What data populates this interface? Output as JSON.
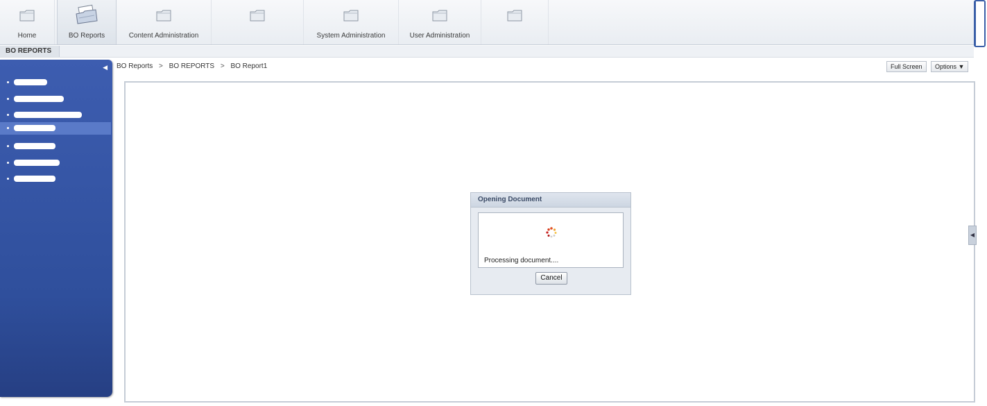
{
  "nav": {
    "tabs": [
      {
        "label": "Home",
        "icon": "folder-icon"
      },
      {
        "label": "BO Reports",
        "icon": "reports-icon",
        "active": true
      },
      {
        "label": "Content Administration",
        "icon": "folder-icon"
      },
      {
        "label": "",
        "icon": "folder-icon"
      },
      {
        "label": "System Administration",
        "icon": "folder-icon"
      },
      {
        "label": "User Administration",
        "icon": "folder-icon"
      },
      {
        "label": "",
        "icon": "folder-icon"
      }
    ]
  },
  "section": {
    "title": "BO REPORTS"
  },
  "sidebar": {
    "collapse_icon": "collapse-left-icon",
    "selected_index": 3,
    "items_count_note": ""
  },
  "breadcrumb": {
    "items": [
      "BO Reports",
      "BO REPORTS",
      "BO Report1"
    ],
    "separator": ">"
  },
  "toolbar": {
    "full_screen_label": "Full Screen",
    "options_label": "Options ▼"
  },
  "dialog": {
    "title": "Opening Document",
    "status": "Processing document....",
    "cancel_label": "Cancel"
  },
  "colors": {
    "sidebar": "#3d5db0",
    "sidebar_selected": "#5a7ac8",
    "accent_frame": "#3a5fa8"
  }
}
